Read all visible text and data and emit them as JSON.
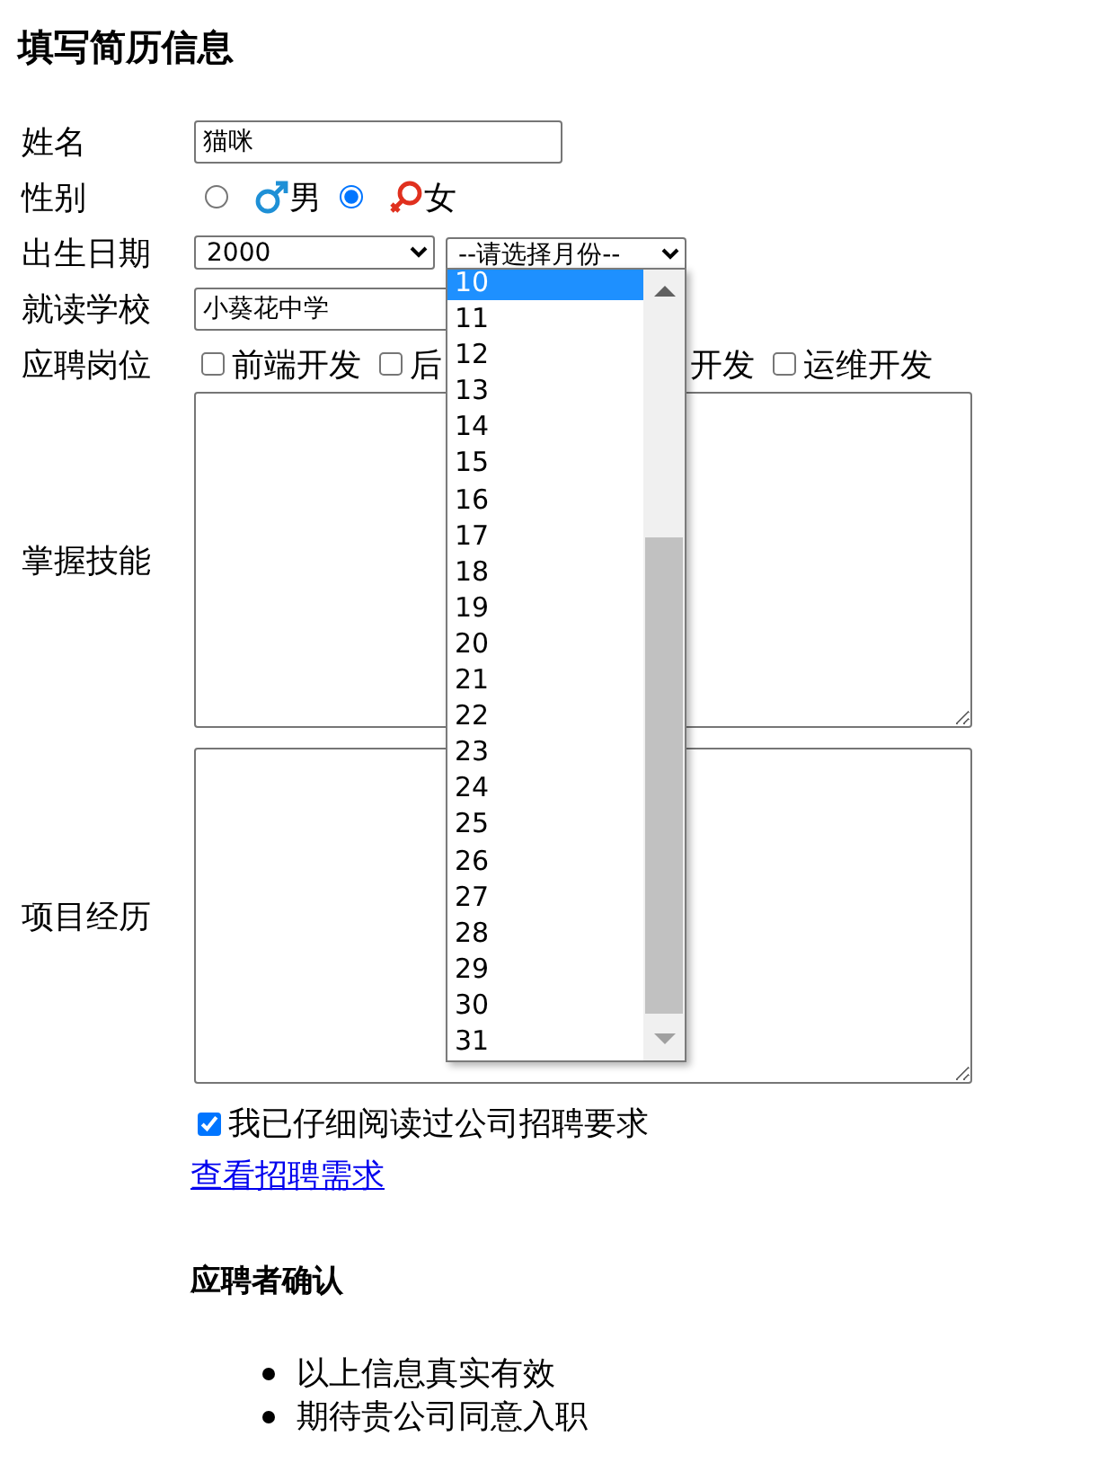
{
  "title": "填写简历信息",
  "name": {
    "label": "姓名",
    "value": "猫咪"
  },
  "gender": {
    "label": "性别",
    "options": [
      {
        "kind": "male",
        "label": "男",
        "selected": false
      },
      {
        "kind": "female",
        "label": "女",
        "selected": true
      }
    ]
  },
  "birth": {
    "label": "出生日期",
    "year": "2000",
    "month": "--请选择月份--",
    "open_list": [
      {
        "label": "10",
        "selected": true
      },
      {
        "label": "11",
        "selected": false
      },
      {
        "label": "12",
        "selected": false
      },
      {
        "label": "13",
        "selected": false
      },
      {
        "label": "14",
        "selected": false
      },
      {
        "label": "15",
        "selected": false
      },
      {
        "label": "16",
        "selected": false
      },
      {
        "label": "17",
        "selected": false
      },
      {
        "label": "18",
        "selected": false
      },
      {
        "label": "19",
        "selected": false
      },
      {
        "label": "20",
        "selected": false
      },
      {
        "label": "21",
        "selected": false
      },
      {
        "label": "22",
        "selected": false
      },
      {
        "label": "23",
        "selected": false
      },
      {
        "label": "24",
        "selected": false
      },
      {
        "label": "25",
        "selected": false
      },
      {
        "label": "26",
        "selected": false
      },
      {
        "label": "27",
        "selected": false
      },
      {
        "label": "28",
        "selected": false
      },
      {
        "label": "29",
        "selected": false
      },
      {
        "label": "30",
        "selected": false
      },
      {
        "label": "31",
        "selected": false
      }
    ]
  },
  "school": {
    "label": "就读学校",
    "value": "小葵花中学"
  },
  "positions": {
    "label": "应聘岗位",
    "items": [
      {
        "kind": "checkbox",
        "label": "前端开发",
        "checked": false
      },
      {
        "kind": "checkbox",
        "label": "后",
        "checked": false
      },
      {
        "kind": "text",
        "label": "开发"
      },
      {
        "kind": "checkbox",
        "label": "运维开发",
        "checked": false
      }
    ]
  },
  "skills": {
    "label": "掌握技能"
  },
  "experience": {
    "label": "项目经历"
  },
  "agree": {
    "label": "我已仔细阅读过公司招聘要求",
    "checked": true
  },
  "link": "查看招聘需求",
  "confirm": {
    "heading": "应聘者确认",
    "items": [
      "以上信息真实有效",
      "期待贵公司同意入职"
    ]
  }
}
